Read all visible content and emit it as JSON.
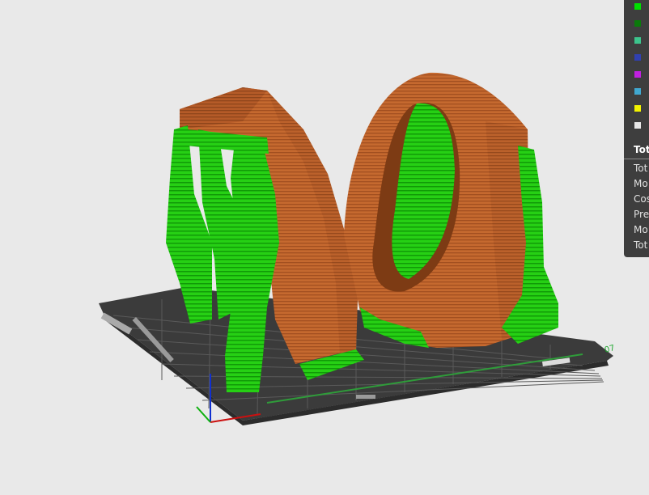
{
  "legend": {
    "items": [
      {
        "color": "#00e000",
        "label": ""
      },
      {
        "color": "#0a7a0a",
        "label": ""
      },
      {
        "color": "#3cc48c",
        "label": ""
      },
      {
        "color": "#3040b0",
        "label": ""
      },
      {
        "color": "#c020e0",
        "label": ""
      },
      {
        "color": "#40a8d0",
        "label": ""
      },
      {
        "color": "#f2f200",
        "label": ""
      },
      {
        "color": "#e8e8e8",
        "label": ""
      }
    ]
  },
  "summary": {
    "title": "Tot",
    "rows": [
      "Tot",
      "Mo",
      "Cos",
      "Pre",
      "Mo",
      "Tot"
    ]
  },
  "bed": {
    "label": "07"
  },
  "colors": {
    "model": "#c0642e",
    "support": "#22cc10",
    "bed": "#4a4a4a",
    "background": "#e9e9e9",
    "panel": "#3e3e3e"
  }
}
